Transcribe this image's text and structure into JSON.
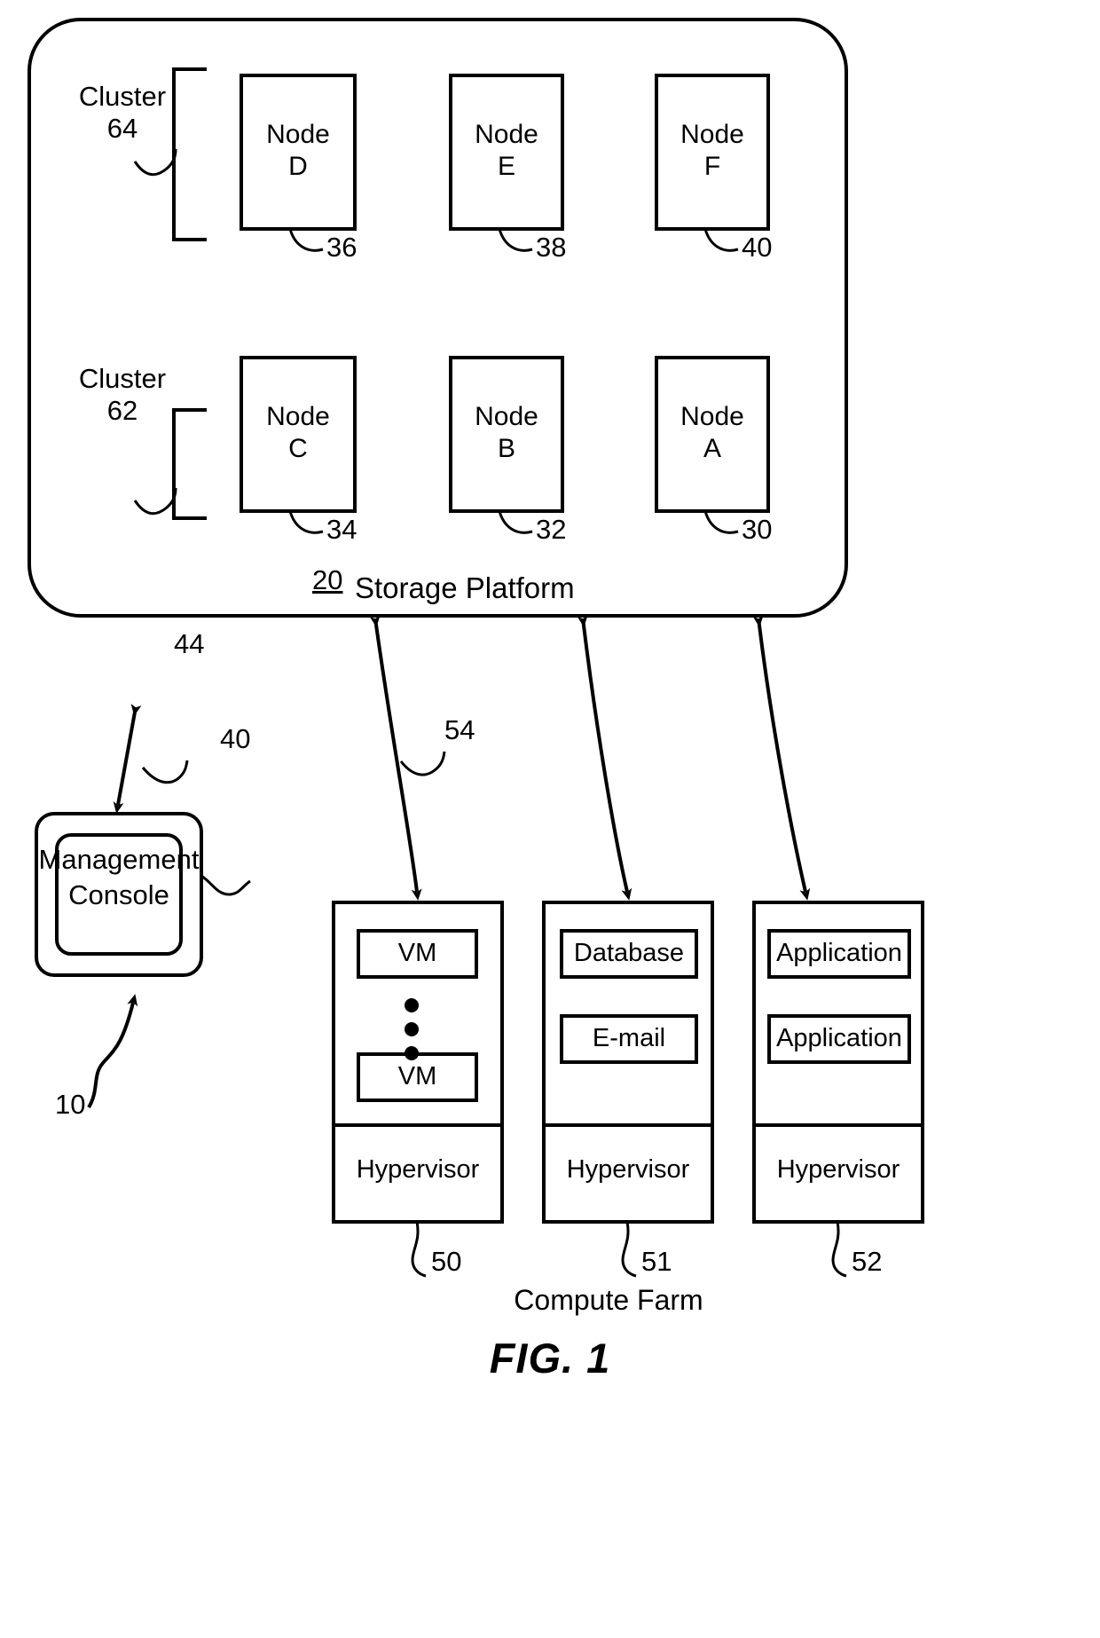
{
  "figure": {
    "caption": "FIG. 1",
    "system_ref": "10",
    "platform": {
      "title": "Storage Platform",
      "ref": "20",
      "clusters": [
        {
          "label_line1": "Cluster",
          "label_line2": "64",
          "nodes": [
            {
              "line1": "Node",
              "line2": "D",
              "ref": "36"
            },
            {
              "line1": "Node",
              "line2": "E",
              "ref": "38"
            },
            {
              "line1": "Node",
              "line2": "F",
              "ref": "40"
            }
          ]
        },
        {
          "label_line1": "Cluster",
          "label_line2": "62",
          "nodes": [
            {
              "line1": "Node",
              "line2": "C",
              "ref": "34"
            },
            {
              "line1": "Node",
              "line2": "B",
              "ref": "32"
            },
            {
              "line1": "Node",
              "line2": "A",
              "ref": "30"
            }
          ]
        }
      ]
    },
    "management_console": {
      "label_line1": "Management",
      "label_line2": "Console",
      "ref": "40",
      "link_ref": "44"
    },
    "compute_farm": {
      "title": "Compute Farm",
      "link_ref": "54",
      "hosts": [
        {
          "ref": "50",
          "items": [
            "VM",
            "VM"
          ],
          "has_ellipsis": true,
          "platform_layer": "Hypervisor"
        },
        {
          "ref": "51",
          "items": [
            "Database",
            "E-mail"
          ],
          "has_ellipsis": false,
          "platform_layer": "Hypervisor"
        },
        {
          "ref": "52",
          "items": [
            "Application",
            "Application"
          ],
          "has_ellipsis": false,
          "platform_layer": "Hypervisor"
        }
      ]
    },
    "colors": {
      "ink": "#000000",
      "paper": "#ffffff"
    }
  }
}
